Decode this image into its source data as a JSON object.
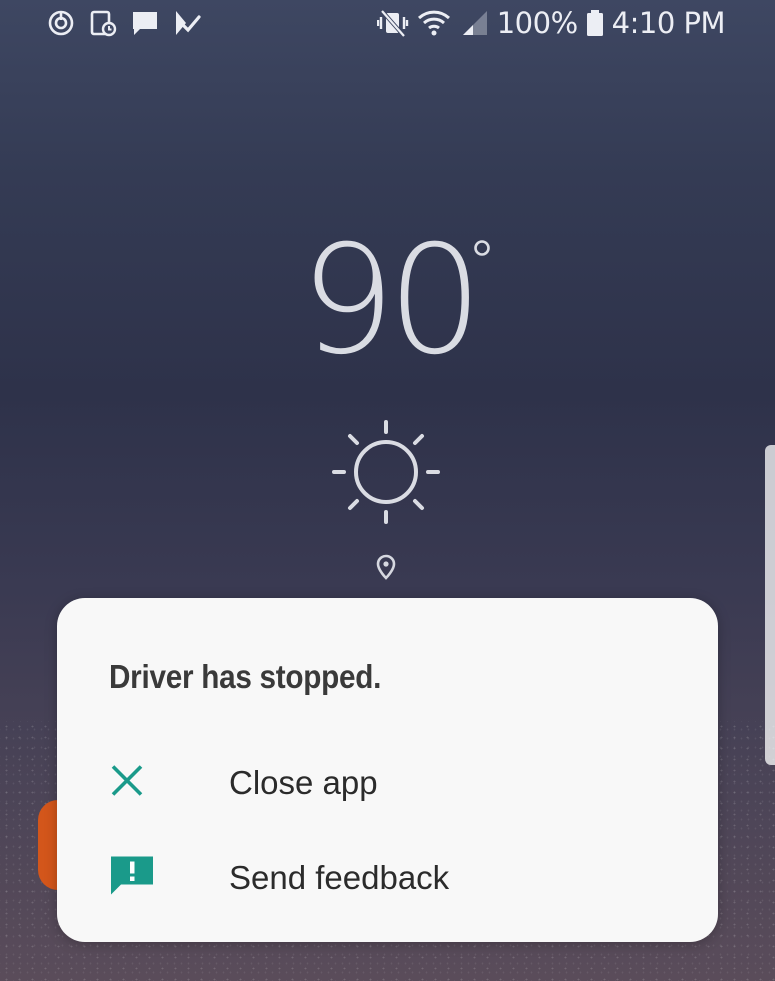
{
  "status_bar": {
    "left_icons": [
      "data-saver-icon",
      "screenshot-icon",
      "message-icon",
      "check-notification-icon"
    ],
    "right_icons": [
      "vibrate-icon",
      "wifi-icon",
      "signal-icon",
      "battery-icon"
    ],
    "battery": "100%",
    "time": "4:10 PM"
  },
  "weather": {
    "temperature": "90",
    "condition_icon": "sun-icon",
    "location_icon": "location-pin-icon"
  },
  "dialog": {
    "title": "Driver has stopped.",
    "options": [
      {
        "label": "Close app",
        "icon": "close-icon"
      },
      {
        "label": "Send feedback",
        "icon": "feedback-icon"
      }
    ],
    "accent_color": "#1a9a8a"
  }
}
